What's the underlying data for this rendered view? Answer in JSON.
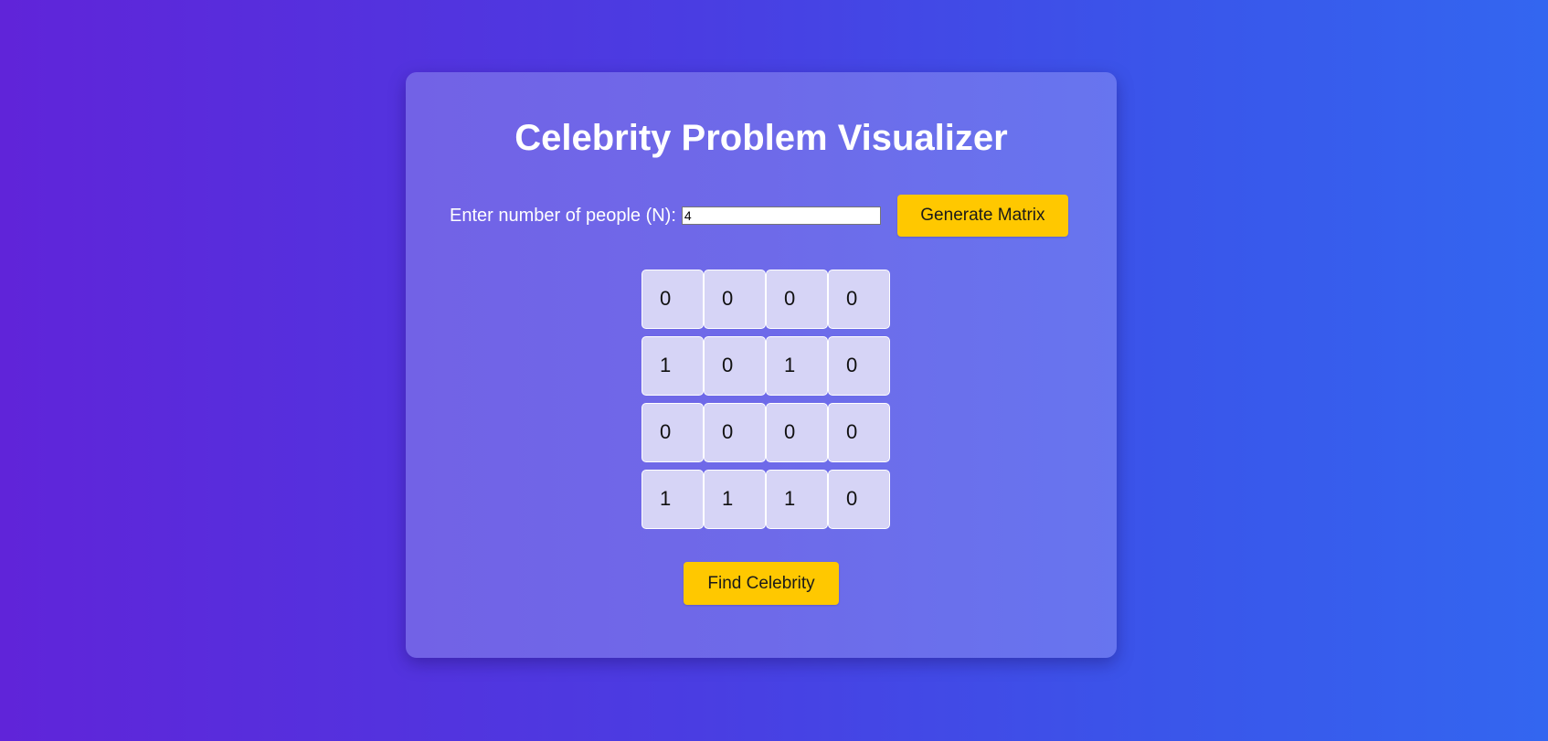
{
  "card": {
    "title": "Celebrity Problem Visualizer"
  },
  "controls": {
    "n_label": "Enter number of people (N):",
    "n_value": "4",
    "generate_label": "Generate Matrix"
  },
  "matrix": {
    "rows": [
      [
        "0",
        "0",
        "0",
        "0"
      ],
      [
        "1",
        "0",
        "1",
        "0"
      ],
      [
        "0",
        "0",
        "0",
        "0"
      ],
      [
        "1",
        "1",
        "1",
        "0"
      ]
    ]
  },
  "actions": {
    "find_label": "Find Celebrity"
  },
  "colors": {
    "accent_button": "#ffc800",
    "cell_background": "#d6d4f6"
  }
}
